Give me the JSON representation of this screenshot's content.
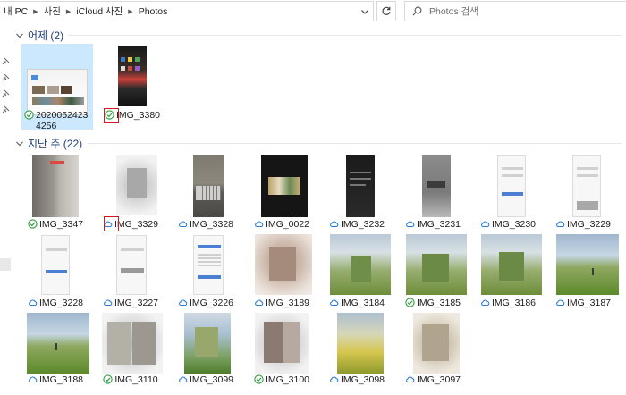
{
  "breadcrumb": [
    "내 PC",
    "사진",
    "iCloud 사진",
    "Photos"
  ],
  "search": {
    "placeholder": "Photos 검색"
  },
  "groups": {
    "yesterday": {
      "title": "어제 (2)"
    },
    "last_week": {
      "title": "지난 주 (22)"
    }
  },
  "files": {
    "yesterday": [
      {
        "name": "20200524234256",
        "status": "synced-check"
      },
      {
        "name": "IMG_3380",
        "status": "synced-check"
      }
    ],
    "last_week_row1": [
      {
        "name": "IMG_3347",
        "status": "synced-check"
      },
      {
        "name": "IMG_3329",
        "status": "cloud"
      },
      {
        "name": "IMG_3328",
        "status": "cloud"
      },
      {
        "name": "IMG_0022",
        "status": "cloud"
      },
      {
        "name": "IMG_3232",
        "status": "cloud"
      },
      {
        "name": "IMG_3231",
        "status": "cloud"
      },
      {
        "name": "IMG_3230",
        "status": "cloud"
      },
      {
        "name": "IMG_3229",
        "status": "cloud"
      }
    ],
    "last_week_row2": [
      {
        "name": "IMG_3228",
        "status": "cloud"
      },
      {
        "name": "IMG_3227",
        "status": "cloud"
      },
      {
        "name": "IMG_3226",
        "status": "cloud"
      },
      {
        "name": "IMG_3189",
        "status": "cloud"
      },
      {
        "name": "IMG_3184",
        "status": "cloud"
      },
      {
        "name": "IMG_3185",
        "status": "synced-check"
      },
      {
        "name": "IMG_3186",
        "status": "cloud"
      },
      {
        "name": "IMG_3187",
        "status": "cloud"
      }
    ],
    "last_week_row3": [
      {
        "name": "IMG_3188",
        "status": "cloud"
      },
      {
        "name": "IMG_3110",
        "status": "synced-check"
      },
      {
        "name": "IMG_3099",
        "status": "cloud"
      },
      {
        "name": "IMG_3100",
        "status": "synced-check"
      },
      {
        "name": "IMG_3098",
        "status": "cloud"
      },
      {
        "name": "IMG_3097",
        "status": "cloud"
      }
    ]
  },
  "colors": {
    "header_text": "#1f3f7a",
    "synced_green": "#2e9e3f",
    "cloud_blue": "#2a7bd6",
    "highlight_red": "#d11a1a",
    "selection": "#cce8ff"
  }
}
